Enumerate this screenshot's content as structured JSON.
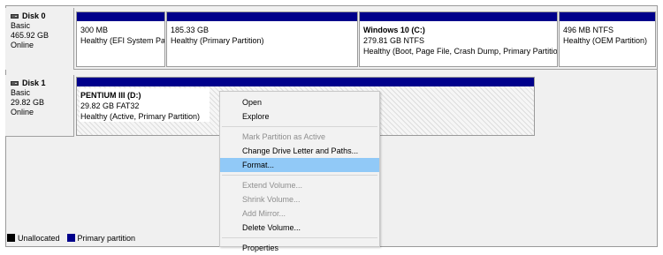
{
  "disks": [
    {
      "name": "Disk 0",
      "type": "Basic",
      "size": "465.92 GB",
      "status": "Online",
      "partitions": [
        {
          "name": "",
          "size": "300 MB",
          "status": "Healthy (EFI System Par"
        },
        {
          "name": "",
          "size": "185.33 GB",
          "status": "Healthy (Primary Partition)"
        },
        {
          "name": "Windows 10  (C:)",
          "size": "279.81 GB NTFS",
          "status": "Healthy (Boot, Page File, Crash Dump, Primary Partition)"
        },
        {
          "name": "",
          "size": "496 MB NTFS",
          "status": "Healthy (OEM Partition)"
        }
      ]
    },
    {
      "name": "Disk 1",
      "type": "Basic",
      "size": "29.82 GB",
      "status": "Online",
      "partitions": [
        {
          "name": "PENTIUM III  (D:)",
          "size": "29.82 GB FAT32",
          "status": "Healthy (Active, Primary Partition)"
        }
      ]
    }
  ],
  "legend": [
    {
      "label": "Unallocated",
      "color": "#000000"
    },
    {
      "label": "Primary partition",
      "color": "#00008b"
    }
  ],
  "context_menu": {
    "groups": [
      [
        {
          "label": "Open",
          "enabled": true
        },
        {
          "label": "Explore",
          "enabled": true
        }
      ],
      [
        {
          "label": "Mark Partition as Active",
          "enabled": false
        },
        {
          "label": "Change Drive Letter and Paths...",
          "enabled": true
        },
        {
          "label": "Format...",
          "enabled": true,
          "highlighted": true
        }
      ],
      [
        {
          "label": "Extend Volume...",
          "enabled": false
        },
        {
          "label": "Shrink Volume...",
          "enabled": false
        },
        {
          "label": "Add Mirror...",
          "enabled": false
        },
        {
          "label": "Delete Volume...",
          "enabled": true
        }
      ],
      [
        {
          "label": "Properties",
          "enabled": true
        }
      ]
    ]
  },
  "colors": {
    "partition_header": "#00008b",
    "menu_highlight": "#91c9f7"
  }
}
